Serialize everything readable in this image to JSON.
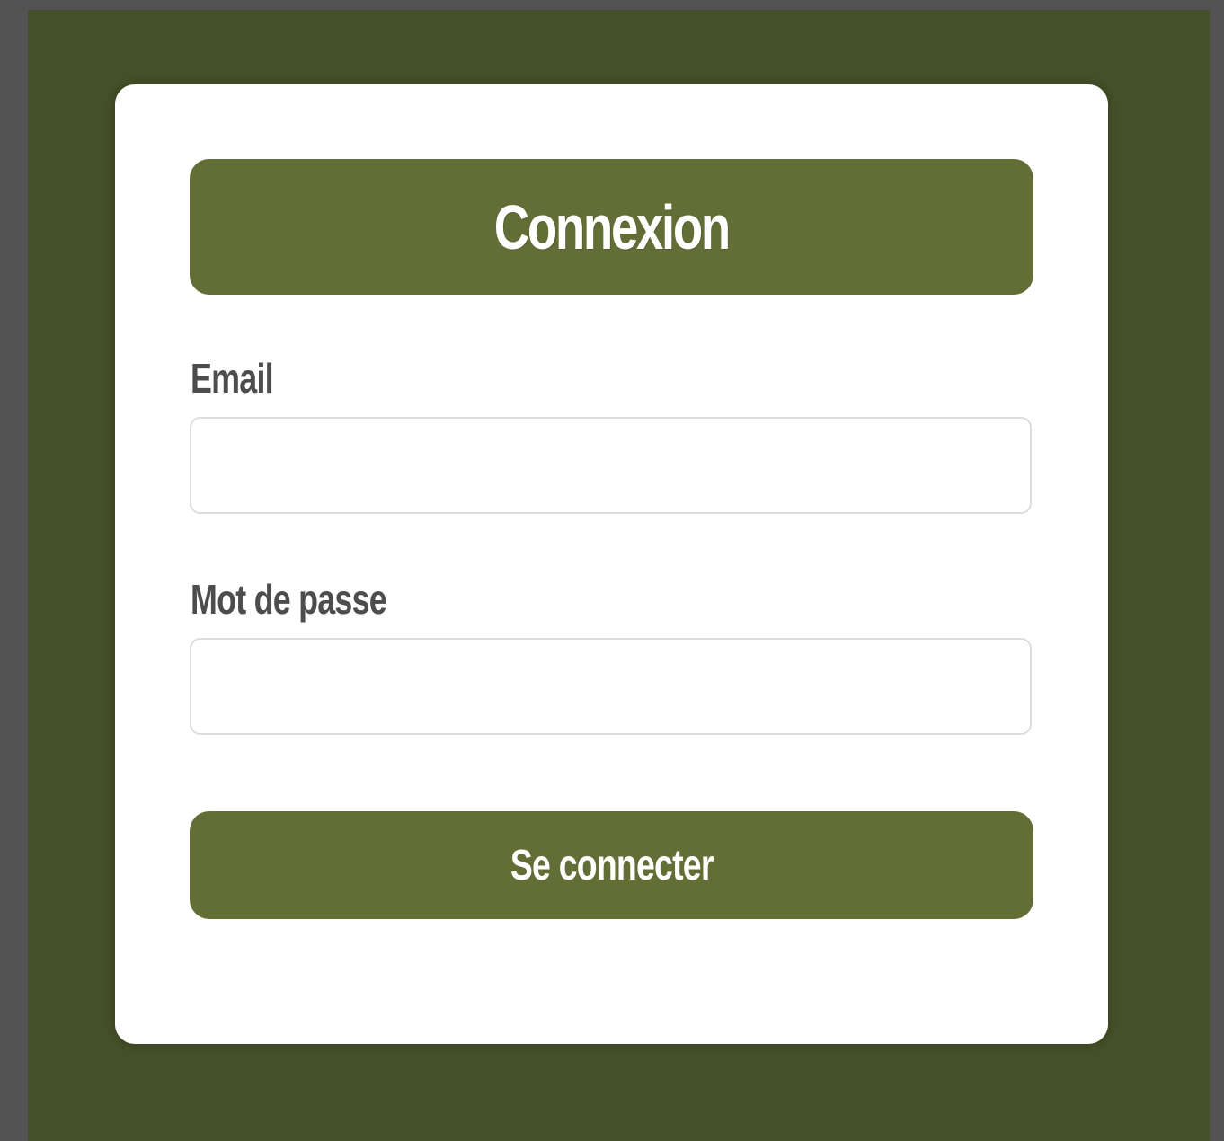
{
  "colors": {
    "outer_background": "#535353",
    "page_background": "#455128",
    "card_background": "#ffffff",
    "accent": "#626e35",
    "label_text": "#4d4d4d",
    "field_border": "#dddddd"
  },
  "login": {
    "title": "Connexion",
    "email_label": "Email",
    "email_value": "",
    "email_placeholder": "",
    "password_label": "Mot de passe",
    "password_value": "",
    "password_placeholder": "",
    "submit_label": "Se connecter"
  }
}
